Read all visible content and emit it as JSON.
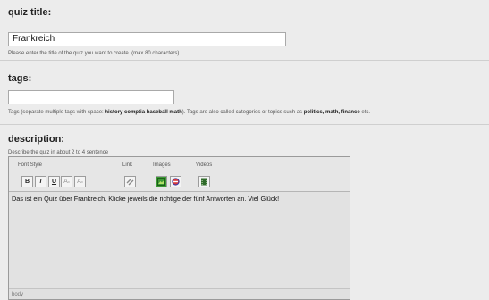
{
  "quiz_title": {
    "label": "quiz title:",
    "value": "Frankreich",
    "hint": "Please enter the title of the quiz you want to create. (max 80 characters)"
  },
  "tags": {
    "label": "tags:",
    "value": "",
    "hint_prefix": "Tags (separate multiple tags with space: ",
    "hint_example": "history comptia baseball math",
    "hint_mid": "). Tags are also called categories or topics such as ",
    "hint_topics": "politics, math, finance",
    "hint_suffix": " etc."
  },
  "description": {
    "label": "description:",
    "hint": "Describe the quiz in about 2 to 4 sentence",
    "toolbar": {
      "font_style_label": "Font Style",
      "link_label": "Link",
      "images_label": "Images",
      "videos_label": "Videos",
      "bold": "B",
      "italic": "I",
      "underline": "U",
      "subscript": "A",
      "superscript": "A"
    },
    "body_text": "Das ist ein Quiz über Frankreich. Klicke jeweils die richtige der fünf Antworten an. Viel Glück!",
    "footer": "body"
  }
}
